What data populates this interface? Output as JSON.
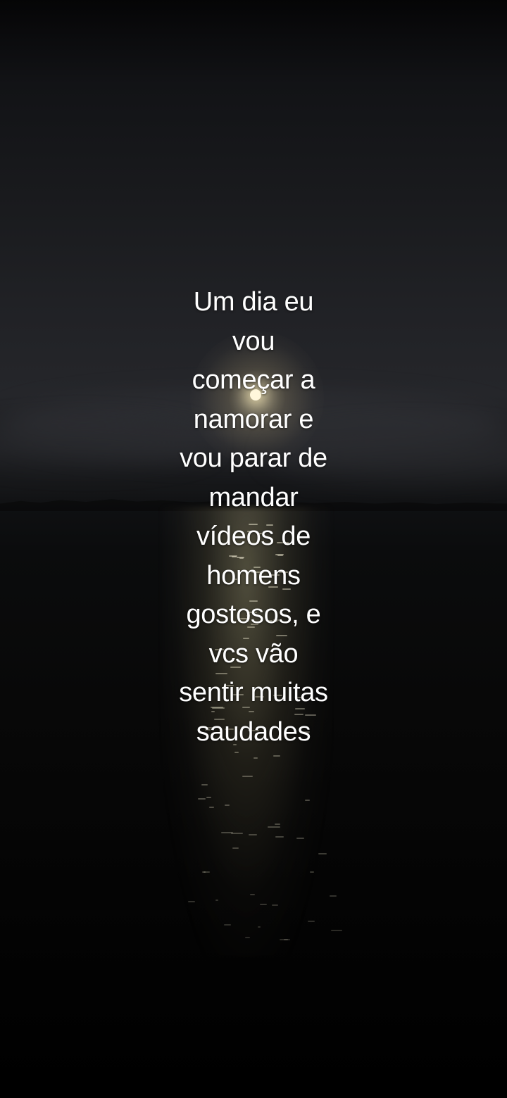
{
  "caption": {
    "lines": [
      "Um dia eu",
      "vou",
      "começar a",
      "namorar e",
      "vou parar de",
      "mandar",
      "vídeos de",
      "homens",
      "gostosos, e",
      "vcs vão",
      "sentir muitas",
      "saudades"
    ]
  },
  "background": {
    "scene": "night-sea-moonlight",
    "colors": {
      "sky_top": "#050506",
      "sky_horizon": "#25262a",
      "moon": "#fff7dc",
      "sea": "#080808",
      "text": "#ffffff"
    }
  }
}
